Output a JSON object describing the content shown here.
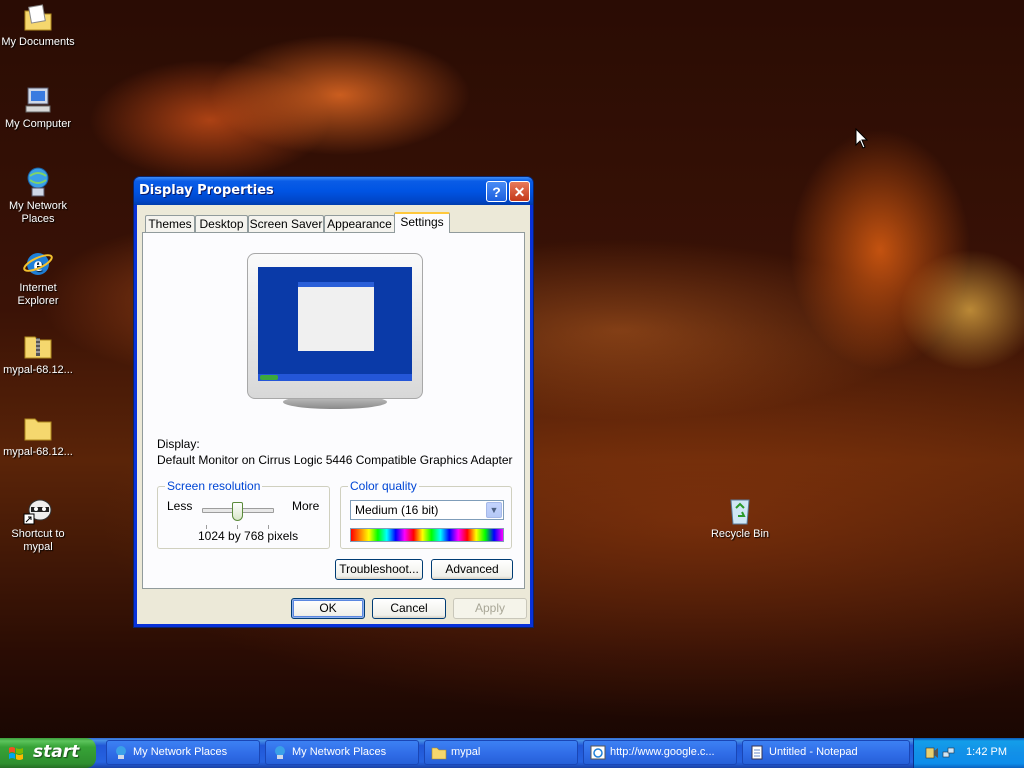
{
  "desktop": {
    "icons": [
      {
        "label": "My Documents",
        "icon": "my-documents-icon"
      },
      {
        "label": "My Computer",
        "icon": "my-computer-icon"
      },
      {
        "label": "My Network Places",
        "icon": "network-places-icon"
      },
      {
        "label": "Internet Explorer",
        "icon": "internet-explorer-icon"
      },
      {
        "label": "mypal-68.12...",
        "icon": "zip-folder-icon"
      },
      {
        "label": "mypal-68.12...",
        "icon": "folder-icon"
      },
      {
        "label": "Shortcut to mypal",
        "icon": "mypal-shortcut-icon"
      },
      {
        "label": "Recycle Bin",
        "icon": "recycle-bin-icon"
      }
    ]
  },
  "dialog": {
    "title": "Display Properties",
    "help_glyph": "?",
    "close_glyph": "✕",
    "tabs": [
      "Themes",
      "Desktop",
      "Screen Saver",
      "Appearance",
      "Settings"
    ],
    "active_tab": "Settings",
    "display_label": "Display:",
    "display_value": "Default Monitor on Cirrus Logic 5446 Compatible Graphics Adapter",
    "resolution": {
      "group_title": "Screen resolution",
      "less": "Less",
      "more": "More",
      "value_text": "1024 by 768 pixels"
    },
    "color": {
      "group_title": "Color quality",
      "selected": "Medium (16 bit)"
    },
    "buttons": {
      "troubleshoot": "Troubleshoot...",
      "advanced": "Advanced",
      "ok": "OK",
      "cancel": "Cancel",
      "apply": "Apply"
    }
  },
  "taskbar": {
    "start_label": "start",
    "tasks": [
      {
        "label": "My Network Places",
        "icon": "network-places-icon"
      },
      {
        "label": "My Network Places",
        "icon": "network-places-icon"
      },
      {
        "label": "mypal",
        "icon": "folder-icon"
      },
      {
        "label": "http://www.google.c...",
        "icon": "browser-icon"
      },
      {
        "label": "Untitled - Notepad",
        "icon": "notepad-icon"
      }
    ],
    "clock": "1:42 PM"
  },
  "colors": {
    "xp_blue": "#0054e3",
    "start_green": "#37a337",
    "tab_highlight": "#ffc83c",
    "group_title": "#0046d5"
  }
}
